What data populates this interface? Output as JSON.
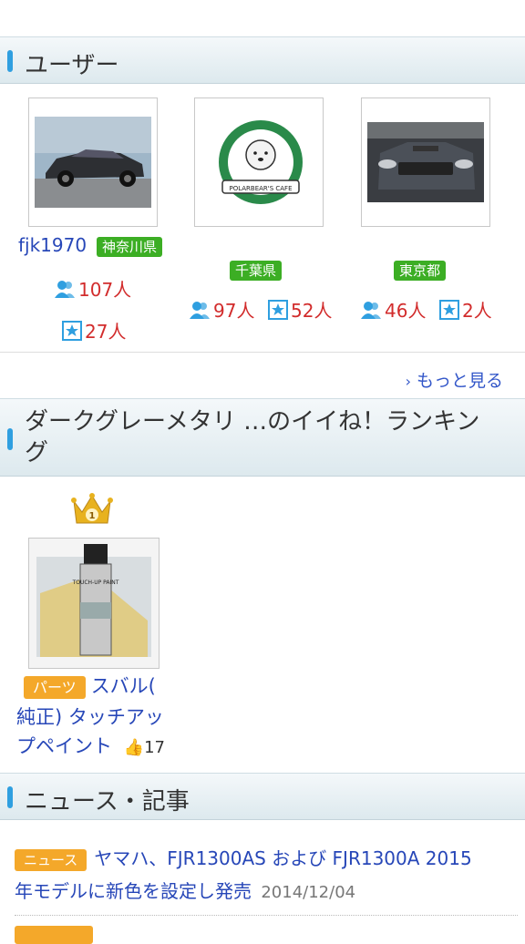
{
  "users_section": {
    "title": "ユーザー"
  },
  "users": [
    {
      "name": "fjk1970",
      "prefecture": "神奈川県",
      "followers": "107人",
      "favorites": "27人"
    },
    {
      "name": "",
      "prefecture": "千葉県",
      "followers": "97人",
      "favorites": "52人",
      "image_caption": "POLARBEAR'S CAFE"
    },
    {
      "name": "",
      "prefecture": "東京都",
      "followers": "46人",
      "favorites": "2人"
    }
  ],
  "more_link": "もっと見る",
  "ranking_section": {
    "title_line1": "ダークグレーメタリ …のイイね！ランキン",
    "title_line2": "グ"
  },
  "ranking_items": [
    {
      "rank": "1",
      "category": "パーツ",
      "title_line1": "スバル(",
      "title_line2": "純正) タッチアッ",
      "title_line3": "プペイント",
      "likes": "17",
      "image_caption": "TOUCH-UP PAINT"
    }
  ],
  "news_section": {
    "title": "ニュース・記事"
  },
  "news": [
    {
      "category": "ニュース",
      "title_line1": "ヤマハ、FJR1300AS および FJR1300A 2015",
      "title_line2": "年モデルに新色を設定し発売",
      "date": "2014/12/04"
    }
  ],
  "colors": {
    "accent": "#2f9fe0",
    "link": "#2747b8",
    "count_red": "#d22c2c",
    "prefecture_green": "#3cae24",
    "badge_orange": "#f4a82a"
  }
}
